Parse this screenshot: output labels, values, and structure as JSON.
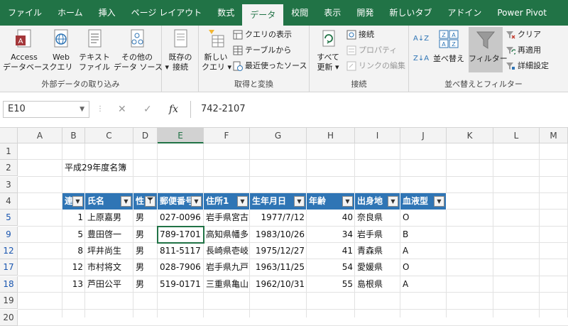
{
  "tabs": [
    "ファイル",
    "ホーム",
    "挿入",
    "ページ レイアウト",
    "数式",
    "データ",
    "校閲",
    "表示",
    "開発",
    "新しいタブ",
    "アドイン",
    "Power Pivot"
  ],
  "active_tab": 5,
  "ribbon": {
    "groups": {
      "external": "外部データの取り込み",
      "transform": "取得と変換",
      "connections": "接続",
      "sortfilter": "並べ替えとフィルター"
    },
    "access": [
      "Access",
      "データベース"
    ],
    "web": [
      "Web",
      "クエリ"
    ],
    "text": [
      "テキスト",
      "ファイル"
    ],
    "other": [
      "その他の",
      "データ ソース ▾"
    ],
    "existing": [
      "既存の",
      "接続"
    ],
    "newquery": [
      "新しい",
      "クエリ ▾"
    ],
    "show_queries": "クエリの表示",
    "from_table": "テーブルから",
    "recent_sources": "最近使ったソース",
    "refresh_all": [
      "すべて",
      "更新 ▾"
    ],
    "connections": "接続",
    "properties": "プロパティ",
    "edit_links": "リンクの編集",
    "sort_az": "A↓Z",
    "sort_za": "Z↓A",
    "sort": "並べ替え",
    "filter": "フィルター",
    "clear": "クリア",
    "reapply": "再適用",
    "advanced": "詳細設定"
  },
  "formula_bar": {
    "name_box": "E10",
    "formula": "742-2107",
    "fx": "fx"
  },
  "columns": [
    "A",
    "B",
    "C",
    "D",
    "E",
    "F",
    "G",
    "H",
    "I",
    "J",
    "K",
    "L",
    "M"
  ],
  "selected_column": "E",
  "rows": [
    "1",
    "2",
    "3",
    "4",
    "5",
    "9",
    "12",
    "17",
    "18",
    "19",
    "20"
  ],
  "title_cell": "平成29年度名簿",
  "table_headers": [
    "連",
    "氏名",
    "性",
    "郵便番号",
    "住所1",
    "生年月日",
    "年齢",
    "出身地",
    "血液型"
  ],
  "table_rows": [
    [
      "1",
      "上原嘉男",
      "男",
      "027-0096",
      "岩手県宮古",
      "1977/7/12",
      "40",
      "奈良県",
      "O"
    ],
    [
      "5",
      "豊田啓一",
      "男",
      "789-1701",
      "高知県幡多",
      "1983/10/26",
      "34",
      "岩手県",
      "B"
    ],
    [
      "8",
      "坪井尚生",
      "男",
      "811-5117",
      "長崎県壱岐",
      "1975/12/27",
      "41",
      "青森県",
      "A"
    ],
    [
      "12",
      "市村将文",
      "男",
      "028-7906",
      "岩手県九戸",
      "1963/11/25",
      "54",
      "愛媛県",
      "O"
    ],
    [
      "13",
      "芦田公平",
      "男",
      "519-0171",
      "三重県亀山",
      "1962/10/31",
      "55",
      "島根県",
      "A"
    ]
  ],
  "colors": {
    "excel_green": "#217346",
    "table_header": "#2f75b5"
  }
}
